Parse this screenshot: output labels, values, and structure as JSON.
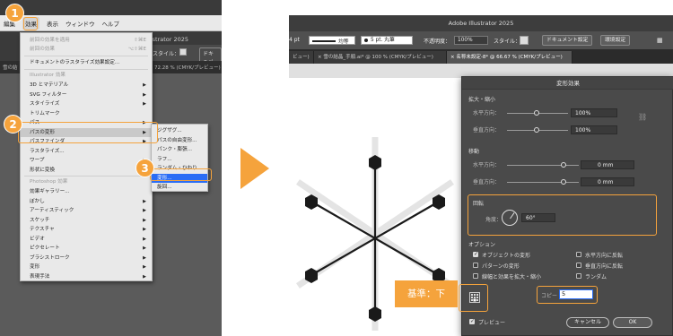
{
  "left": {
    "menubar": {
      "item1": "編集",
      "item2": "効果",
      "item3": "表示",
      "item4": "ウィンドウ",
      "item5": "ヘルプ"
    },
    "app_title": "Illustrator 2025",
    "control_style_label": "スタイル：",
    "control_doc_button": "ドキュメ",
    "doc_tab_text": "72.28 % (CMYK/プレビュー)",
    "doc_tab_left": "雪の結",
    "menu": {
      "apply_last": "前回の効果を適用",
      "apply_last_shortcut": "⇧⌘E",
      "last_effect": "前回の効果",
      "last_effect_shortcut": "⌥⇧⌘E",
      "raster_settings": "ドキュメントのラスタライズ効果設定...",
      "illustrator_header": "Illustrator 効果",
      "illustrator_items": [
        "3D とマテリアル",
        "SVG フィルター",
        "スタイライズ",
        "トリムマーク",
        "パス",
        "パスの変形",
        "パスファインダ",
        "ラスタライズ...",
        "ワープ",
        "形状に変換"
      ],
      "photoshop_header": "Photoshop 効果",
      "photoshop_items": [
        "効果ギャラリー...",
        "ぼかし",
        "アーティスティック",
        "スケッチ",
        "テクスチャ",
        "ビデオ",
        "ピクセレート",
        "ブラシストローク",
        "変形",
        "表現手法"
      ]
    },
    "submenu": {
      "items": [
        "ジグザグ...",
        "パスの自由変形...",
        "パンク・膨張...",
        "ラフ...",
        "ランダム・ひねり...",
        "変形...",
        "旋回..."
      ]
    },
    "badges": {
      "b1": "1",
      "b2": "2",
      "b3": "3"
    }
  },
  "right": {
    "title": "Adobe Illustrator 2025",
    "control": {
      "stroke_width": "4 pt",
      "stroke_style": "均等",
      "brush": "5 pt. 丸筆",
      "opacity_label": "不透明度：",
      "opacity": "100%",
      "style_label": "スタイル：",
      "doc_setup": "ドキュメント設定",
      "prefs": "環境設定"
    },
    "tabs": [
      "ビュー)",
      "雪の結晶_手順.ai* @ 100 % (CMYK/プレビュー)",
      "名称未設定-8* @ 66.67 % (CMYK/プレビュー)"
    ],
    "dialog": {
      "title": "変形効果",
      "scale_header": "拡大・縮小",
      "horizontal_scale_label": "水平方向：",
      "horizontal_scale_value": "100%",
      "vertical_scale_label": "垂直方向：",
      "vertical_scale_value": "100%",
      "move_header": "移動",
      "horizontal_move_label": "水平方向：",
      "horizontal_move_value": "0 mm",
      "vertical_move_label": "垂直方向：",
      "vertical_move_value": "0 mm",
      "rotate_header": "回転",
      "angle_label": "角度：",
      "angle_value": "60°",
      "options_header": "オプション",
      "opt_transform_objects": "オブジェクトの変形",
      "opt_transform_patterns": "パターンの変形",
      "opt_scale_strokes": "線幅と効果を拡大・縮小",
      "opt_flip_h": "水平方向に反転",
      "opt_flip_v": "垂直方向に反転",
      "opt_random": "ランダム",
      "copies_label": "コピー",
      "copies_value": "5",
      "preview_label": "プレビュー",
      "cancel_label": "キャンセル",
      "ok_label": "OK"
    },
    "base_point_label": "基準：下"
  },
  "accent_color": "#f5a33c",
  "selection_color": "#2a6df5"
}
